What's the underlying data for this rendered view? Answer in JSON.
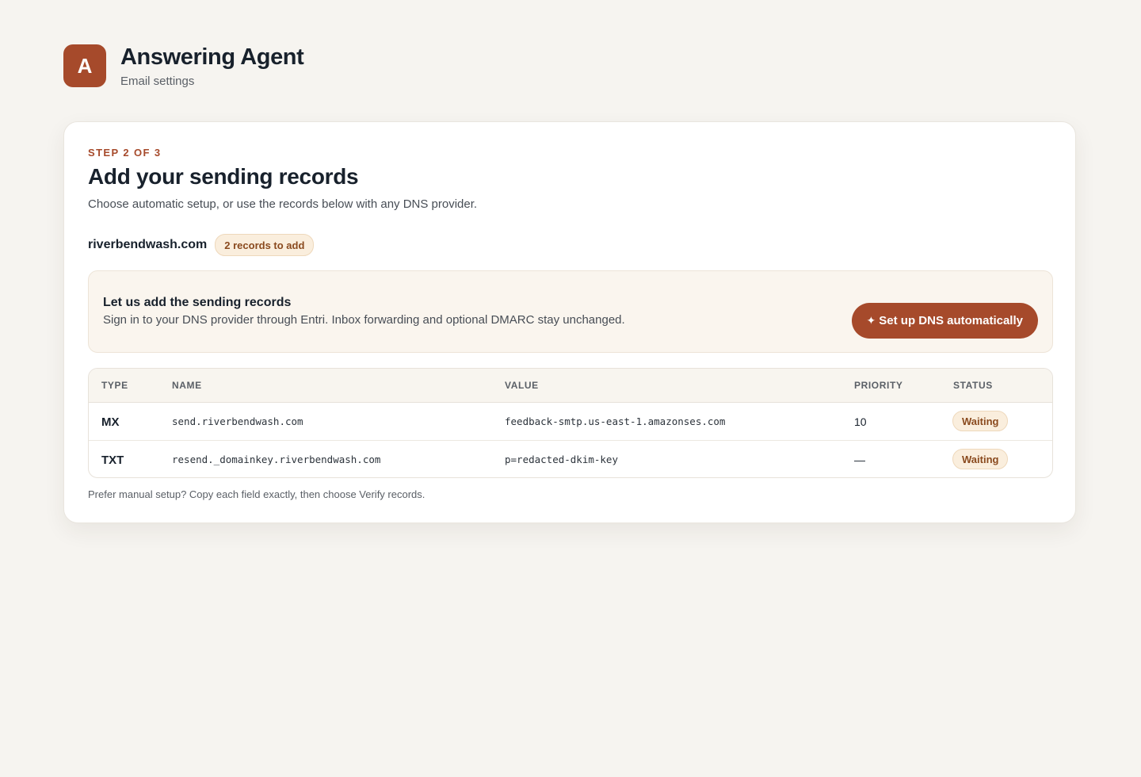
{
  "app": {
    "logo_letter": "A",
    "title": "Answering Agent",
    "subtitle": "Email settings"
  },
  "card": {
    "step_label": "STEP 2 OF 3",
    "title": "Add your sending records",
    "subtitle": "Choose automatic setup, or use the records below with any DNS provider.",
    "domain": "riverbendwash.com",
    "records_badge": "2 records to add",
    "auto_setup": {
      "title": "Let us add the sending records",
      "description": "Sign in to your DNS provider through Entri. Inbox forwarding and optional DMARC stay unchanged.",
      "button_icon": "sparkle-icon",
      "button_label": "Set up DNS automatically",
      "sparkle_glyph": "✦"
    },
    "table": {
      "columns": [
        "TYPE",
        "NAME",
        "VALUE",
        "PRIORITY",
        "STATUS"
      ],
      "rows": [
        {
          "type": "MX",
          "name": "send.riverbendwash.com",
          "value": "feedback-smtp.us-east-1.amazonses.com",
          "priority": "10",
          "status": "Waiting"
        },
        {
          "type": "TXT",
          "name": "resend._domainkey.riverbendwash.com",
          "value": "p=redacted-dkim-key",
          "priority": "—",
          "status": "Waiting"
        }
      ]
    },
    "footnote": "Prefer manual setup? Copy each field exactly, then choose Verify records."
  },
  "colors": {
    "accent": "#a64a2b",
    "background": "#f6f4f0",
    "badge_bg": "#faeedd",
    "badge_text": "#8a4a1e"
  }
}
